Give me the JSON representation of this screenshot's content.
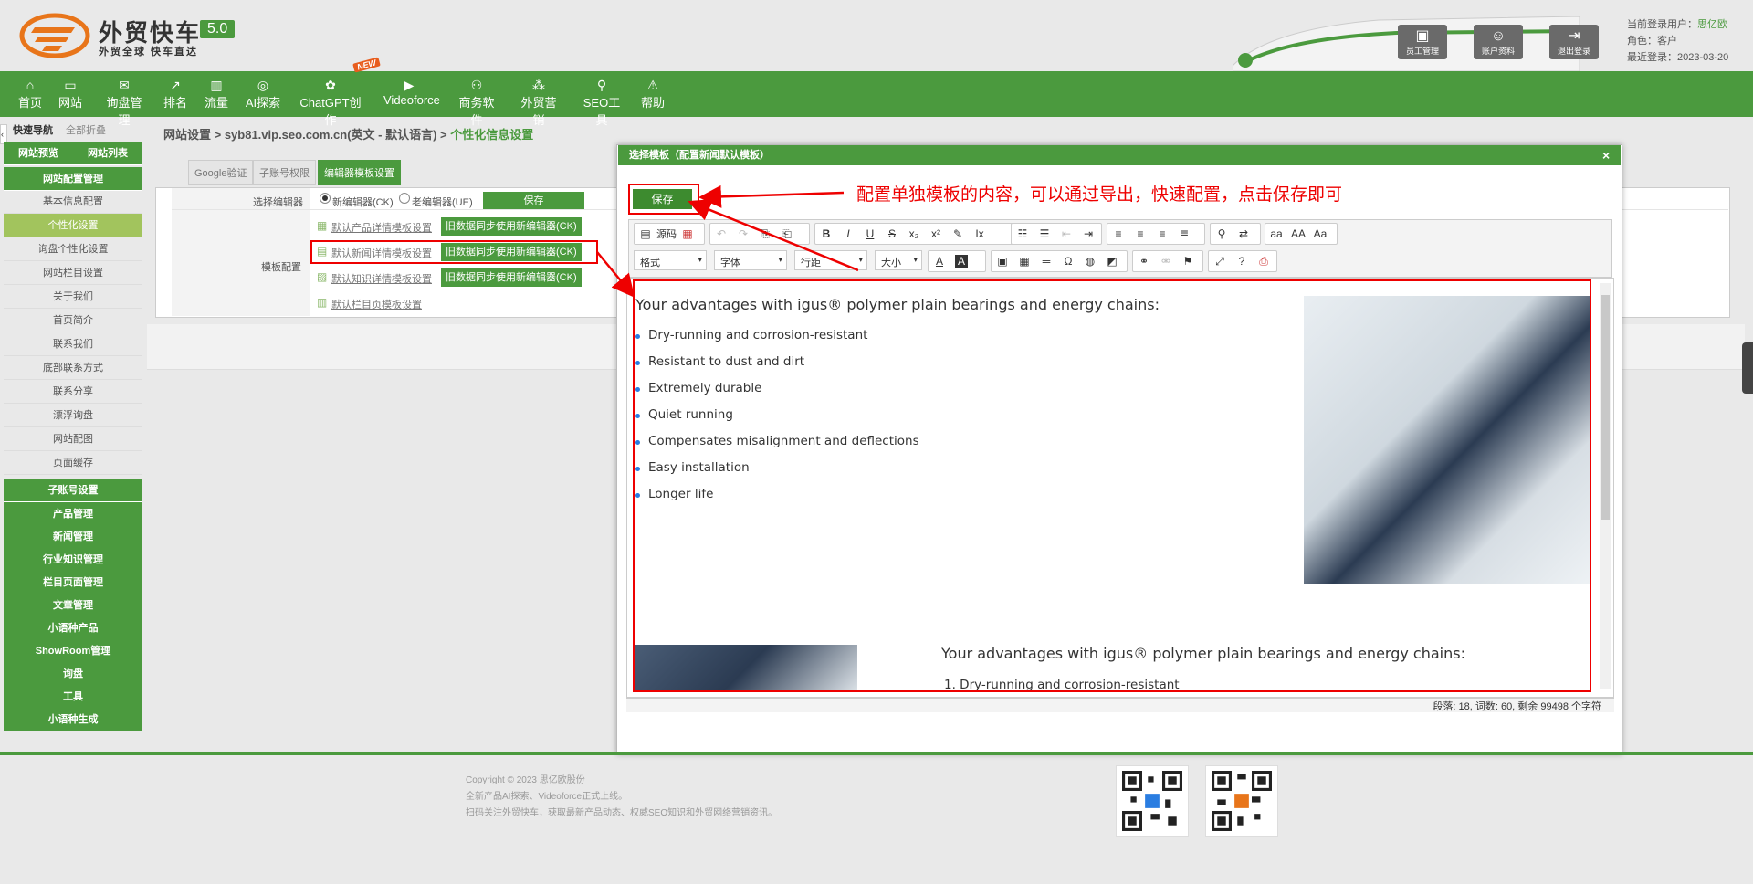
{
  "header": {
    "brand": "外贸快车",
    "slogan": "外贸全球 快车直达",
    "version": "5.0",
    "buttons": [
      {
        "label": "员工管理",
        "icon": "id-card-icon"
      },
      {
        "label": "账户资料",
        "icon": "user-icon"
      },
      {
        "label": "退出登录",
        "icon": "logout-icon"
      }
    ],
    "user": {
      "current_label": "当前登录用户：",
      "current_value": "思亿欧",
      "role_label": "角色：",
      "role_value": "客户",
      "last_label": "最近登录：",
      "last_value": "2023-03-20"
    }
  },
  "nav": {
    "items": [
      {
        "label": "首页",
        "icon": "home-icon"
      },
      {
        "label": "网站",
        "icon": "monitor-icon"
      },
      {
        "label": "询盘管理",
        "icon": "mail-icon"
      },
      {
        "label": "排名",
        "icon": "rank-icon"
      },
      {
        "label": "流量",
        "icon": "bar-chart-icon"
      },
      {
        "label": "AI探索",
        "icon": "ai-icon"
      },
      {
        "label": "ChatGPT创作",
        "icon": "chatgpt-icon"
      },
      {
        "label": "Videoforce",
        "icon": "video-icon"
      },
      {
        "label": "商务软件",
        "icon": "software-icon"
      },
      {
        "label": "外贸营销",
        "icon": "marketing-icon"
      },
      {
        "label": "SEO工具",
        "icon": "search-icon"
      },
      {
        "label": "帮助",
        "icon": "warning-icon"
      }
    ],
    "new_badge": "NEW"
  },
  "sidebar": {
    "tab_active": "快速导航",
    "tab_other": "全部折叠",
    "preview": "网站预览",
    "list": "网站列表",
    "section": "网站配置管理",
    "items": [
      "基本信息配置",
      "个性化设置",
      "询盘个性化设置",
      "网站栏目设置",
      "关于我们",
      "首页简介",
      "联系我们",
      "底部联系方式",
      "联系分享",
      "漂浮询盘",
      "网站配图",
      "页面缓存"
    ],
    "groups": [
      "子账号设置",
      "产品管理",
      "新闻管理",
      "行业知识管理",
      "栏目页面管理",
      "文章管理",
      "小语种产品",
      "ShowRoom管理",
      "询盘",
      "工具",
      "小语种生成"
    ]
  },
  "breadcrumb": {
    "part1": "网站设置 > syb81.vip.seo.com.cn(英文 - 默认语言) > ",
    "current": "个性化信息设置"
  },
  "tabs": [
    "Google验证",
    "子账号权限",
    "编辑器模板设置"
  ],
  "form": {
    "editor_label": "选择编辑器",
    "radio_new": "新编辑器(CK)",
    "radio_old": "老编辑器(UE)",
    "save": "保存",
    "template_label": "模板配置",
    "links": [
      "默认产品详情模板设置",
      "默认新闻详情模板设置",
      "默认知识详情模板设置",
      "默认栏目页模板设置"
    ],
    "sync": "旧数据同步使用新编辑器(CK)"
  },
  "modal": {
    "title": "选择模板（配置新闻默认模板）",
    "close": "×",
    "save": "保存",
    "source": "源码",
    "dropdowns": [
      "格式",
      "字体",
      "行距",
      "大小"
    ],
    "status": "段落: 18, 词数: 60, 剩余 99498 个字符",
    "content": {
      "heading": "Your advantages with igus® polymer plain bearings and energy chains:",
      "bullets": [
        "Dry-running and corrosion-resistant",
        "Resistant to dust and dirt",
        "Extremely durable",
        "Quiet running",
        "Compensates misalignment and deflections",
        "Easy installation",
        "Longer life"
      ],
      "ordered_first": "1. Dry-running and corrosion-resistant"
    }
  },
  "annotation": "配置单独模板的内容，可以通过导出，快速配置，点击保存即可",
  "footer": {
    "line1": "Copyright © 2023 思亿欧股份",
    "line2": "全新产品AI探索、Videoforce正式上线。",
    "line3": "扫码关注外贸快车，获取最新产品动态、权威SEO知识和外贸网络营销资讯。"
  },
  "colors": {
    "brand_green": "#4b9a3e",
    "annotation_red": "#ee0000",
    "logo_orange": "#e8751a"
  }
}
